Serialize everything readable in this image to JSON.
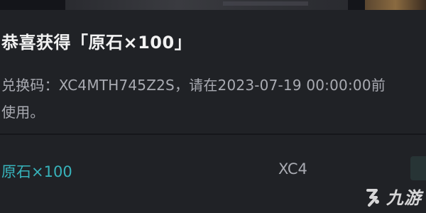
{
  "mail": {
    "title": "恭喜获得「原石×100」",
    "body_line1": "兑换码：XC4MTH745Z2S，请在2023-07-19 00:00:00前",
    "body_line2": "使用。"
  },
  "reward": {
    "name": "原石×100",
    "code_preview": "XC4"
  },
  "watermark": {
    "icon": "jiuyou-logo-icon",
    "text": "九游"
  },
  "colors": {
    "background": "#202226",
    "title": "#f2f2f2",
    "body_text": "#a9abb2",
    "reward_accent": "#37b3bb"
  }
}
